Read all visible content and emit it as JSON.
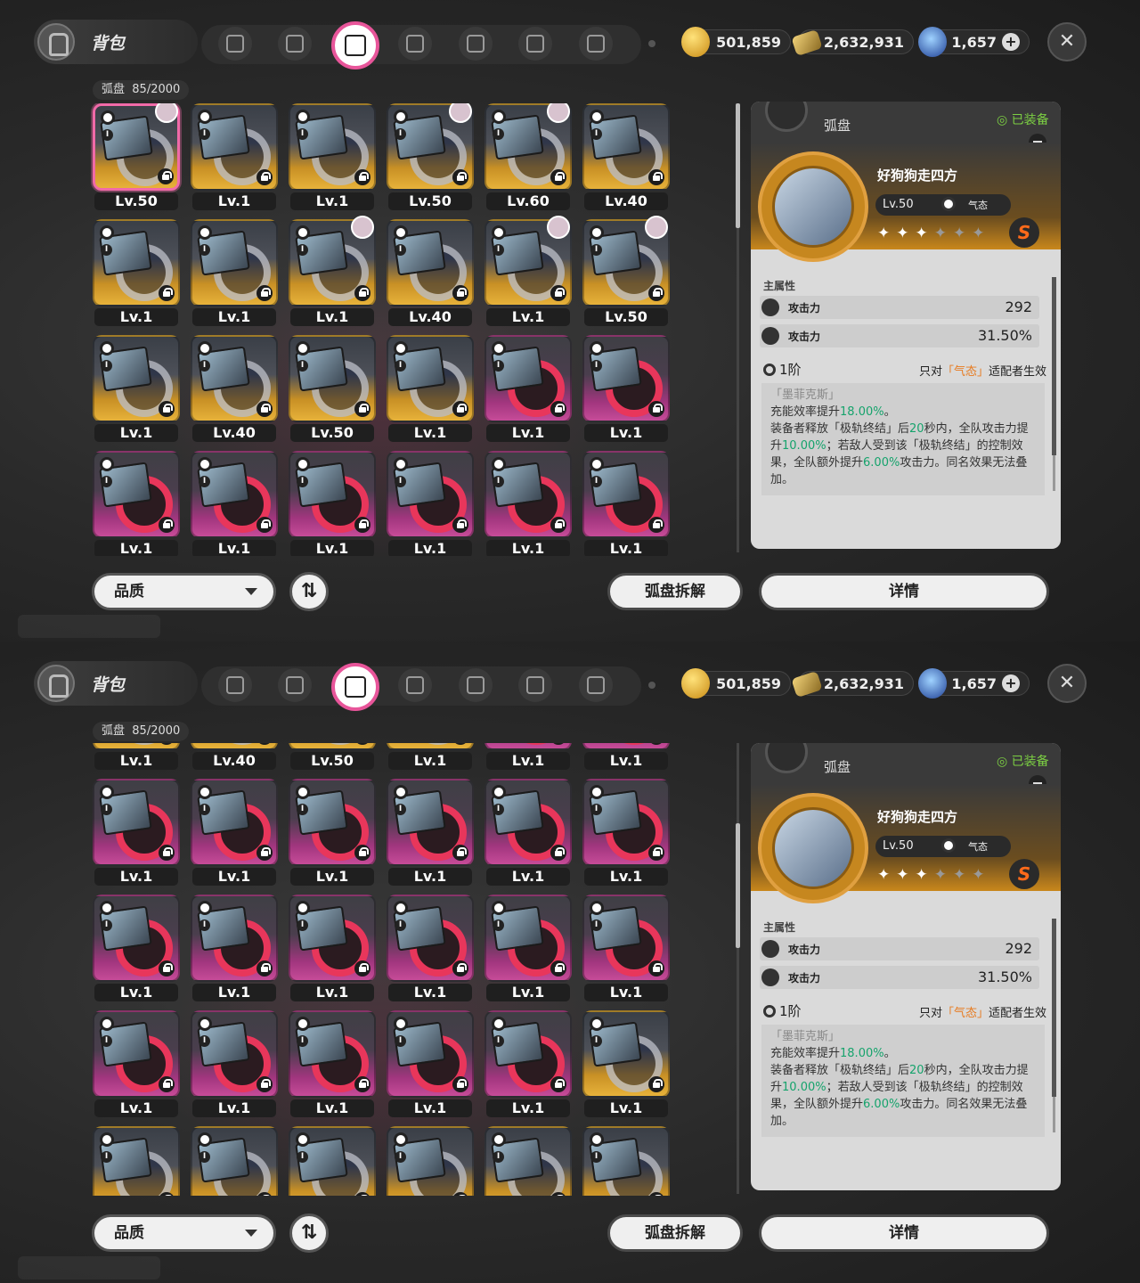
{
  "header": {
    "title": "背包",
    "gold": "501,859",
    "tickets": "2,632,931",
    "gems": "1,657",
    "plus": "+",
    "close": "✕"
  },
  "tabs": [
    {
      "name": "tab-agents"
    },
    {
      "name": "tab-devices"
    },
    {
      "name": "tab-discs",
      "active": true
    },
    {
      "name": "tab-materials"
    },
    {
      "name": "tab-food"
    },
    {
      "name": "tab-bangboo"
    },
    {
      "name": "tab-home"
    }
  ],
  "inventory": {
    "label": "弧盘",
    "count": "85/2000"
  },
  "top_grid": [
    {
      "q": "gold",
      "lv": "Lv.50",
      "avatar": true,
      "selected": true
    },
    {
      "q": "gold",
      "lv": "Lv.1"
    },
    {
      "q": "gold",
      "lv": "Lv.1"
    },
    {
      "q": "gold",
      "lv": "Lv.50",
      "avatar": true
    },
    {
      "q": "gold",
      "lv": "Lv.60",
      "avatar": true
    },
    {
      "q": "gold",
      "lv": "Lv.40"
    },
    {
      "q": "gold",
      "lv": "Lv.1"
    },
    {
      "q": "gold",
      "lv": "Lv.1"
    },
    {
      "q": "gold",
      "lv": "Lv.1",
      "avatar": true
    },
    {
      "q": "gold",
      "lv": "Lv.40"
    },
    {
      "q": "gold",
      "lv": "Lv.1",
      "avatar": true
    },
    {
      "q": "gold",
      "lv": "Lv.50",
      "avatar": true
    },
    {
      "q": "gold",
      "lv": "Lv.1"
    },
    {
      "q": "gold",
      "lv": "Lv.40"
    },
    {
      "q": "gold",
      "lv": "Lv.50"
    },
    {
      "q": "gold",
      "lv": "Lv.1"
    },
    {
      "q": "pink",
      "lv": "Lv.1"
    },
    {
      "q": "pink",
      "lv": "Lv.1"
    },
    {
      "q": "pink",
      "lv": "Lv.1"
    },
    {
      "q": "pink",
      "lv": "Lv.1"
    },
    {
      "q": "pink",
      "lv": "Lv.1"
    },
    {
      "q": "pink",
      "lv": "Lv.1"
    },
    {
      "q": "pink",
      "lv": "Lv.1"
    },
    {
      "q": "pink",
      "lv": "Lv.1"
    }
  ],
  "bottom_grid": [
    {
      "q": "gold",
      "lv": "Lv.1"
    },
    {
      "q": "gold",
      "lv": "Lv.40"
    },
    {
      "q": "gold",
      "lv": "Lv.50"
    },
    {
      "q": "gold",
      "lv": "Lv.1"
    },
    {
      "q": "pink",
      "lv": "Lv.1"
    },
    {
      "q": "pink",
      "lv": "Lv.1"
    },
    {
      "q": "pink",
      "lv": "Lv.1"
    },
    {
      "q": "pink",
      "lv": "Lv.1"
    },
    {
      "q": "pink",
      "lv": "Lv.1"
    },
    {
      "q": "pink",
      "lv": "Lv.1"
    },
    {
      "q": "pink",
      "lv": "Lv.1"
    },
    {
      "q": "pink",
      "lv": "Lv.1"
    },
    {
      "q": "pink",
      "lv": "Lv.1"
    },
    {
      "q": "pink",
      "lv": "Lv.1"
    },
    {
      "q": "pink",
      "lv": "Lv.1"
    },
    {
      "q": "pink",
      "lv": "Lv.1"
    },
    {
      "q": "pink",
      "lv": "Lv.1"
    },
    {
      "q": "pink",
      "lv": "Lv.1"
    },
    {
      "q": "pink",
      "lv": "Lv.1"
    },
    {
      "q": "pink",
      "lv": "Lv.1"
    },
    {
      "q": "pink",
      "lv": "Lv.1"
    },
    {
      "q": "pink",
      "lv": "Lv.1"
    },
    {
      "q": "pink",
      "lv": "Lv.1"
    },
    {
      "q": "gold",
      "lv": "Lv.1"
    },
    {
      "q": "gold",
      "lv": ""
    },
    {
      "q": "gold",
      "lv": ""
    },
    {
      "q": "gold",
      "lv": ""
    },
    {
      "q": "gold",
      "lv": ""
    },
    {
      "q": "gold",
      "lv": ""
    },
    {
      "q": "gold",
      "lv": ""
    }
  ],
  "detail": {
    "type": "弧盘",
    "equipped": "已装备",
    "name": "好狗狗走四方",
    "level": "Lv.50",
    "attribute": "气态",
    "stars_on": "✦✦✦",
    "stars_off": "✦✦✦",
    "rank": "S",
    "main_attr_label": "主属性",
    "stats": [
      {
        "name": "攻击力",
        "value": "292"
      },
      {
        "name": "攻击力",
        "value": "31.50%"
      }
    ],
    "tier": "1阶",
    "restrict_pre": "只对",
    "restrict_hl": "「气态」",
    "restrict_post": "适配者生效",
    "desc_title": "「墨菲克斯」",
    "desc_l1a": "充能效率提升",
    "desc_l1b": "18.00%",
    "desc_l1c": "。",
    "desc_l2a": "装备者释放「极轨终结」后",
    "desc_l2b": "20",
    "desc_l2c": "秒内，全队攻击力提",
    "desc_l3a": "升",
    "desc_l3b": "10.00%",
    "desc_l3c": "；若敌人受到该「极轨终结」的控制效",
    "desc_l4a": "果，全队额外提升",
    "desc_l4b": "6.00%",
    "desc_l4c": "攻击力。同名效果无法叠",
    "desc_l5": "加。"
  },
  "bottom": {
    "quality": "品质",
    "sort": "⇅",
    "dismantle": "弧盘拆解",
    "details": "详情"
  },
  "colors": {
    "accent": "#e8559a",
    "gold_rarity": "#e7b23a",
    "pink_rarity": "#c64b98",
    "green": "#16a36c",
    "orange": "#e77a1e"
  }
}
